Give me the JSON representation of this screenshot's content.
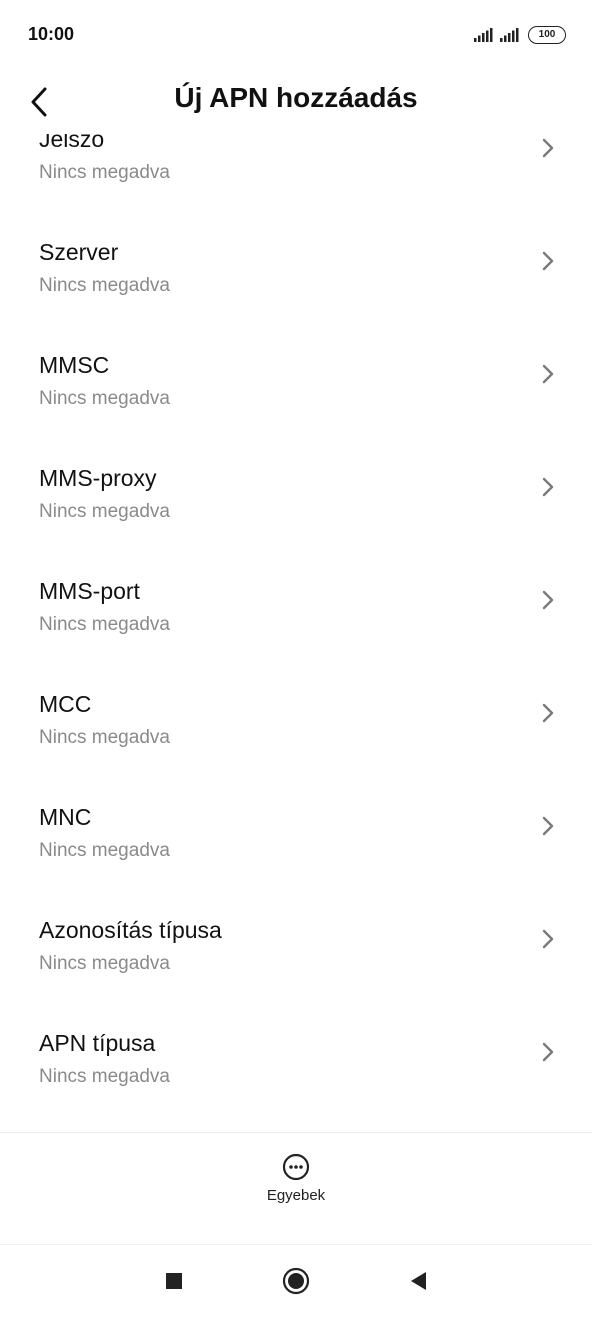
{
  "status_bar": {
    "time": "10:00",
    "battery": "100",
    "icons": [
      "signal-icon",
      "signal-icon",
      "battery-icon"
    ]
  },
  "header": {
    "title": "Új APN hozzáadás",
    "back_icon": "back-arrow-icon"
  },
  "list": {
    "items": [
      {
        "title": "Jelszó",
        "value": "Nincs megadva"
      },
      {
        "title": "Szerver",
        "value": "Nincs megadva"
      },
      {
        "title": "MMSC",
        "value": "Nincs megadva"
      },
      {
        "title": "MMS-proxy",
        "value": "Nincs megadva"
      },
      {
        "title": "MMS-port",
        "value": "Nincs megadva"
      },
      {
        "title": "MCC",
        "value": "Nincs megadva"
      },
      {
        "title": "MNC",
        "value": "Nincs megadva"
      },
      {
        "title": "Azonosítás típusa",
        "value": "Nincs megadva"
      },
      {
        "title": "APN típusa",
        "value": "Nincs megadva"
      }
    ]
  },
  "bottom_action": {
    "label": "Egyebek",
    "icon": "more-icon"
  },
  "nav_bar": {
    "icons": [
      "recents-icon",
      "home-icon",
      "back-icon"
    ]
  }
}
